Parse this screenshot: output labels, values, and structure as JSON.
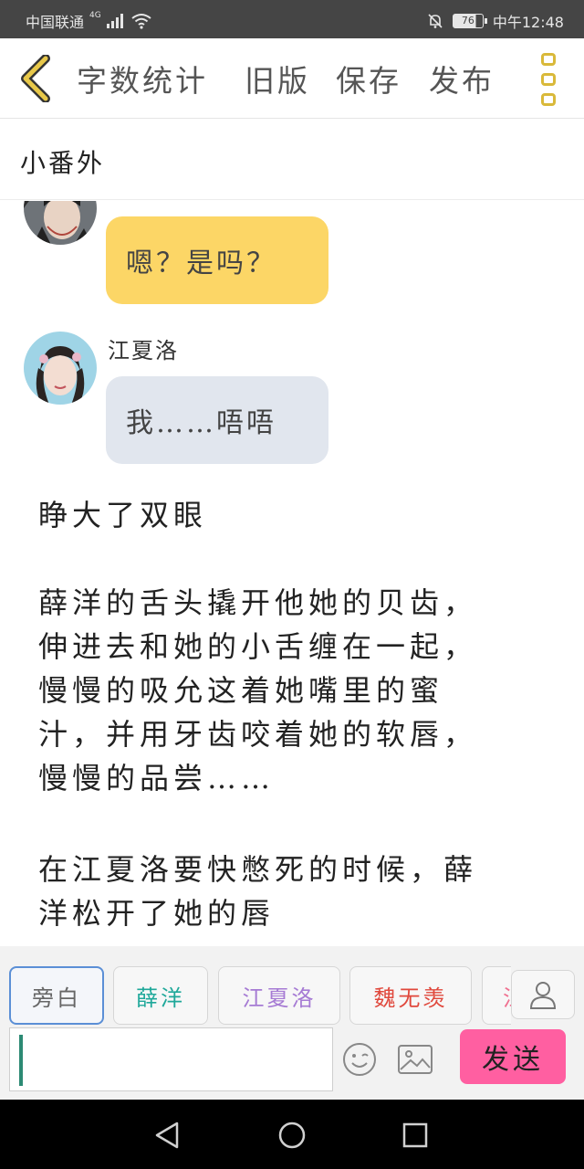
{
  "status_bar": {
    "carrier": "中国联通",
    "network": "4G",
    "battery": "76",
    "time": "中午12:48"
  },
  "toolbar": {
    "word_count": "字数统计",
    "old_version": "旧版",
    "save": "保存",
    "publish": "发布",
    "accent_color": "#d9b93a"
  },
  "chapter": {
    "title": "小番外"
  },
  "messages": [
    {
      "speaker": "",
      "text": "嗯？是吗？",
      "bubble_color": "#fcd666"
    },
    {
      "speaker": "江夏洛",
      "text": "我……唔唔",
      "bubble_color": "#e1e6ee"
    }
  ],
  "narration": [
    "睁大了双眼",
    "薛洋的舌头撬开他她的贝齿，\n伸进去和她的小舌缠在一起，\n慢慢的吸允这着她嘴里的蜜\n汁，并用牙齿咬着她的软唇，\n慢慢的品尝……",
    "在江夏洛要快憋死的时候，薛\n洋松开了她的唇"
  ],
  "characters": [
    {
      "label": "旁白",
      "color": "#666666"
    },
    {
      "label": "薛洋",
      "color": "#1fa89a"
    },
    {
      "label": "江夏洛",
      "color": "#a67bd4"
    },
    {
      "label": "魏无羡",
      "color": "#e0483c"
    },
    {
      "label": "江",
      "color": "#f07090"
    }
  ],
  "composer": {
    "send": "发送",
    "send_color": "#ff5fa1"
  }
}
